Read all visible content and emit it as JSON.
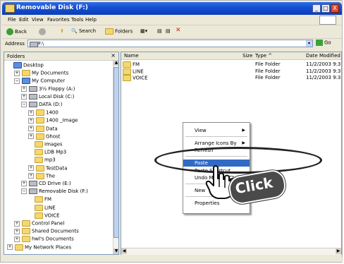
{
  "window": {
    "title": "Removable Disk (F:)",
    "controls": [
      "_",
      "□",
      "X"
    ]
  },
  "menu": [
    "File",
    "Edit",
    "View",
    "Favorites",
    "Tools",
    "Help"
  ],
  "toolbar": {
    "back": "Back",
    "search": "Search",
    "folders": "Folders"
  },
  "address": {
    "label": "Address",
    "value": "F:\\",
    "go": "Go"
  },
  "folders_pane": {
    "title": "Folders",
    "close": "×",
    "items": [
      {
        "label": "Desktop",
        "indent": 0,
        "exp": "",
        "icon": "desktop"
      },
      {
        "label": "My Documents",
        "indent": 1,
        "exp": "+",
        "icon": "folder"
      },
      {
        "label": "My Computer",
        "indent": 1,
        "exp": "−",
        "icon": "computer"
      },
      {
        "label": "3½ Floppy (A:)",
        "indent": 2,
        "exp": "+",
        "icon": "drive"
      },
      {
        "label": "Local Disk (C:)",
        "indent": 2,
        "exp": "+",
        "icon": "drive"
      },
      {
        "label": "DATA (D:)",
        "indent": 2,
        "exp": "−",
        "icon": "drive"
      },
      {
        "label": "1400",
        "indent": 3,
        "exp": "+",
        "icon": "folder"
      },
      {
        "label": "1400 _Image",
        "indent": 3,
        "exp": "+",
        "icon": "folder"
      },
      {
        "label": "Data",
        "indent": 3,
        "exp": "+",
        "icon": "folder"
      },
      {
        "label": "Ghost",
        "indent": 3,
        "exp": "+",
        "icon": "folder"
      },
      {
        "label": "Images",
        "indent": 3,
        "exp": "",
        "icon": "folder"
      },
      {
        "label": "LDB Mp3",
        "indent": 3,
        "exp": "",
        "icon": "folder"
      },
      {
        "label": "mp3",
        "indent": 3,
        "exp": "",
        "icon": "folder"
      },
      {
        "label": "TestData",
        "indent": 3,
        "exp": "+",
        "icon": "folder"
      },
      {
        "label": "The",
        "indent": 3,
        "exp": "+",
        "icon": "folder"
      },
      {
        "label": "CD Drive (E:)",
        "indent": 2,
        "exp": "+",
        "icon": "drive"
      },
      {
        "label": "Removable Disk (F:)",
        "indent": 2,
        "exp": "−",
        "icon": "drive"
      },
      {
        "label": "FM",
        "indent": 3,
        "exp": "",
        "icon": "folder"
      },
      {
        "label": "LINE",
        "indent": 3,
        "exp": "",
        "icon": "folder"
      },
      {
        "label": "VOICE",
        "indent": 3,
        "exp": "",
        "icon": "folder"
      },
      {
        "label": "Control Panel",
        "indent": 1,
        "exp": "+",
        "icon": "folder"
      },
      {
        "label": "Shared Documents",
        "indent": 1,
        "exp": "+",
        "icon": "folder"
      },
      {
        "label": "hwl's Documents",
        "indent": 1,
        "exp": "+",
        "icon": "folder"
      },
      {
        "label": "My Network Places",
        "indent": 0,
        "exp": "+",
        "icon": "folder"
      }
    ]
  },
  "files_pane": {
    "columns": {
      "name": "Name",
      "size": "Size",
      "type": "Type ^",
      "date": "Date Modified"
    },
    "rows": [
      {
        "name": "FM",
        "type": "File Folder",
        "date": "11/2/2003 9:3"
      },
      {
        "name": "LINE",
        "type": "File Folder",
        "date": "11/2/2003 9:3"
      },
      {
        "name": "VOICE",
        "type": "File Folder",
        "date": "11/2/2003 9:3"
      }
    ]
  },
  "context_menu": {
    "items": [
      {
        "label": "View",
        "submenu": true
      },
      {
        "label": "Arrange Icons By",
        "submenu": true
      },
      {
        "label": "Refresh",
        "submenu": false
      },
      {
        "label": "Paste",
        "submenu": false,
        "highlighted": true
      },
      {
        "label": "Paste Shortcut",
        "submenu": false
      },
      {
        "label": "Undo Move",
        "submenu": false,
        "shortcut": "Ctrl+Z"
      },
      {
        "label": "New",
        "submenu": true
      },
      {
        "label": "Properties",
        "submenu": false
      }
    ]
  },
  "annotation": {
    "click_text": "Click"
  }
}
